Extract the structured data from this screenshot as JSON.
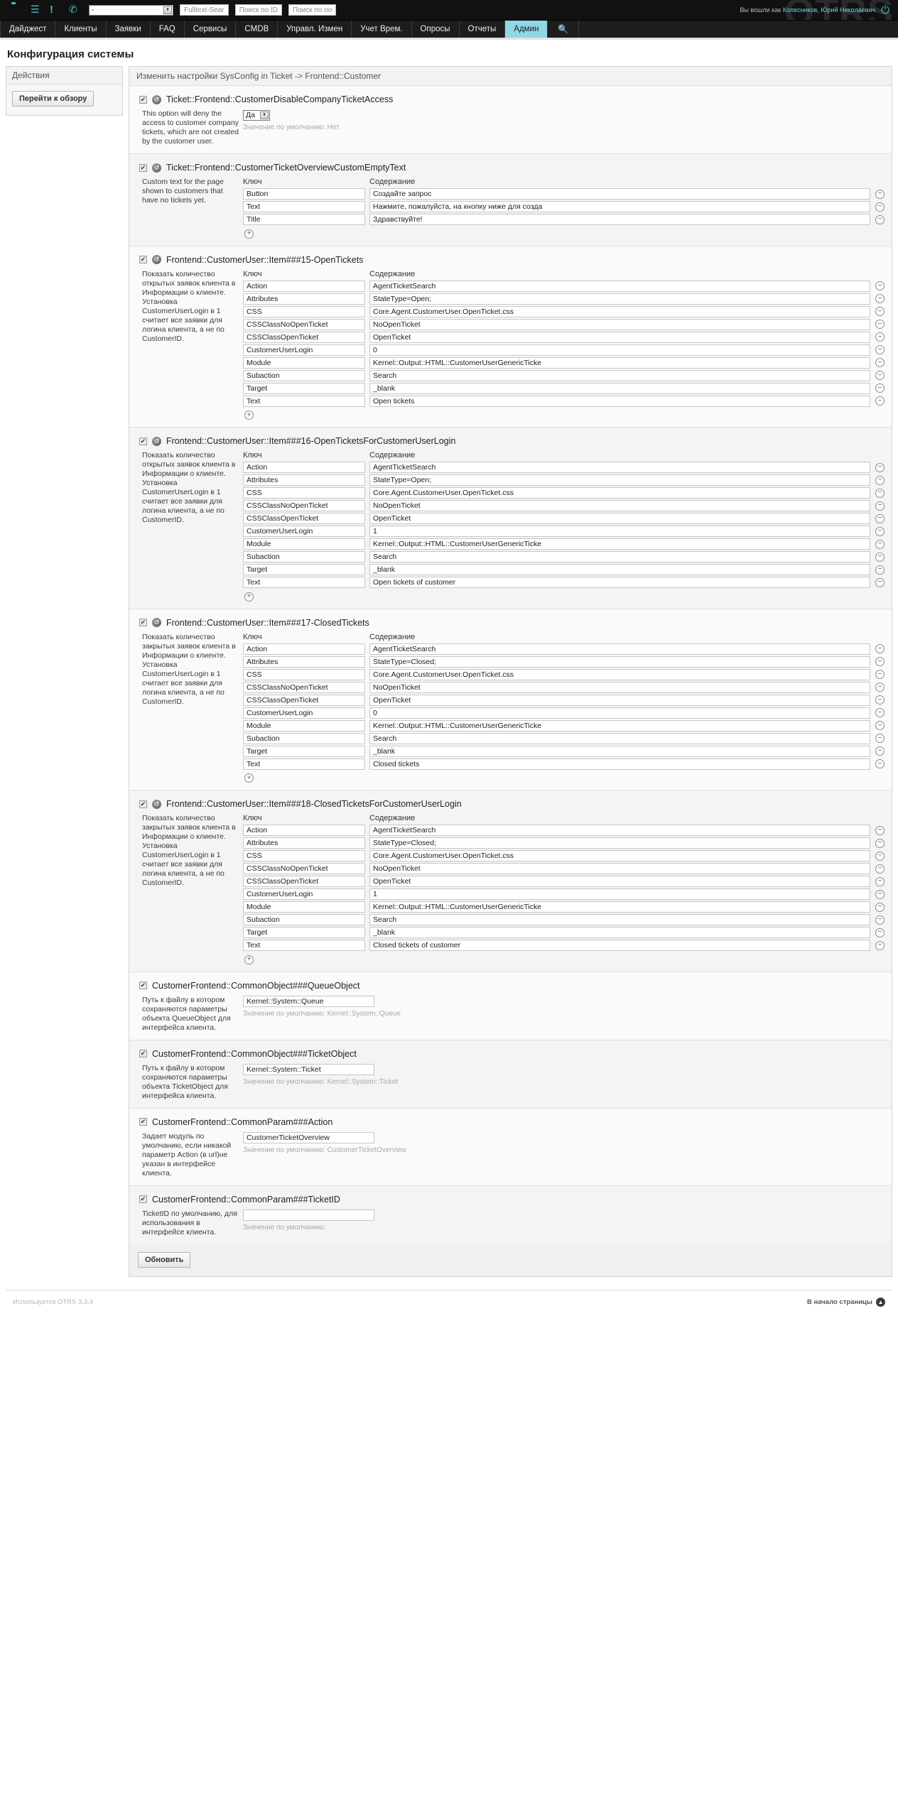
{
  "topbar": {
    "icons": [
      "folder-icon",
      "list-icon",
      "exclamation-icon",
      "phone-icon"
    ],
    "queue_select_value": "-",
    "buttons": [
      {
        "name": "fulltext-search-button",
        "label": "Fulltext-Sear"
      },
      {
        "name": "search-by-id-button",
        "label": "Поиск по ID"
      },
      {
        "name": "search-by-number-button",
        "label": "Поиск по no"
      }
    ],
    "logged_in_prefix": "Вы вошли как ",
    "logged_in_user": "Колесников, Юрий Николаевич",
    "watermark": "OTRS",
    "logout_icon": "power-icon"
  },
  "nav": {
    "items": [
      {
        "label": "Дайджест",
        "active": false
      },
      {
        "label": "Клиенты",
        "active": false
      },
      {
        "label": "Заявки",
        "active": false
      },
      {
        "label": "FAQ",
        "active": false
      },
      {
        "label": "Сервисы",
        "active": false
      },
      {
        "label": "CMDB",
        "active": false
      },
      {
        "label": "Управл. Измен",
        "active": false
      },
      {
        "label": "Учет Врем.",
        "active": false
      },
      {
        "label": "Опросы",
        "active": false
      },
      {
        "label": "Отчеты",
        "active": false
      },
      {
        "label": "Админ",
        "active": true
      }
    ],
    "search_icon": "search-icon"
  },
  "page_title": "Конфигурация системы",
  "sidebar": {
    "header": "Действия",
    "overview_button": "Перейти к обзору"
  },
  "main": {
    "header": "Изменить настройки SysConfig in Ticket -> Frontend::Customer",
    "submit_label": "Обновить",
    "labels": {
      "key": "Ключ",
      "content": "Содержание",
      "default_prefix": "Значение по умолчанию: ",
      "add_icon": "plus-circle-icon",
      "remove_icon": "minus-circle-icon",
      "reset_icon": "reset-icon",
      "checkbox_icon": "checkbox-checked-icon"
    },
    "settings": [
      {
        "name": "Ticket::Frontend::CustomerDisableCompanyTicketAccess",
        "checked": true,
        "has_reset": true,
        "description": "This option will deny the access to customer company tickets, which are not created by the customer user.",
        "type": "select",
        "value": "Да",
        "default": "Нет"
      },
      {
        "name": "Ticket::Frontend::CustomerTicketOverviewCustomEmptyText",
        "checked": true,
        "has_reset": true,
        "description": "Custom text for the page shown to customers that have no tickets yet.",
        "type": "hash",
        "rows": [
          {
            "key": "Button",
            "content": "Создайте запрос"
          },
          {
            "key": "Text",
            "content": "Нажмите, пожалуйста, на кнопку ниже для созда"
          },
          {
            "key": "Title",
            "content": "Здравствуйте!"
          }
        ]
      },
      {
        "name": "Frontend::CustomerUser::Item###15-OpenTickets",
        "checked": true,
        "has_reset": true,
        "description": "Показать количество открытых заявок клиента в Информации о клиенте. Установка CustomerUserLogin в 1 считает все заявки для логина клиента, а не по CustomerID.",
        "type": "hash",
        "rows": [
          {
            "key": "Action",
            "content": "AgentTicketSearch"
          },
          {
            "key": "Attributes",
            "content": "StateType=Open;"
          },
          {
            "key": "CSS",
            "content": "Core.Agent.CustomerUser.OpenTicket.css"
          },
          {
            "key": "CSSClassNoOpenTicket",
            "content": "NoOpenTicket"
          },
          {
            "key": "CSSClassOpenTicket",
            "content": "OpenTicket"
          },
          {
            "key": "CustomerUserLogin",
            "content": "0"
          },
          {
            "key": "Module",
            "content": "Kernel::Output::HTML::CustomerUserGenericTicke"
          },
          {
            "key": "Subaction",
            "content": "Search"
          },
          {
            "key": "Target",
            "content": "_blank"
          },
          {
            "key": "Text",
            "content": "Open tickets"
          }
        ]
      },
      {
        "name": "Frontend::CustomerUser::Item###16-OpenTicketsForCustomerUserLogin",
        "checked": true,
        "has_reset": true,
        "description": "Показать количество открытых заявок клиента в Информации о клиенте. Установка CustomerUserLogin в 1 считает все заявки для логина клиента, а не по CustomerID.",
        "type": "hash",
        "rows": [
          {
            "key": "Action",
            "content": "AgentTicketSearch"
          },
          {
            "key": "Attributes",
            "content": "StateType=Open;"
          },
          {
            "key": "CSS",
            "content": "Core.Agent.CustomerUser.OpenTicket.css"
          },
          {
            "key": "CSSClassNoOpenTicket",
            "content": "NoOpenTicket"
          },
          {
            "key": "CSSClassOpenTicket",
            "content": "OpenTicket"
          },
          {
            "key": "CustomerUserLogin",
            "content": "1"
          },
          {
            "key": "Module",
            "content": "Kernel::Output::HTML::CustomerUserGenericTicke"
          },
          {
            "key": "Subaction",
            "content": "Search"
          },
          {
            "key": "Target",
            "content": "_blank"
          },
          {
            "key": "Text",
            "content": "Open tickets of customer"
          }
        ]
      },
      {
        "name": "Frontend::CustomerUser::Item###17-ClosedTickets",
        "checked": true,
        "has_reset": true,
        "description": "Показать количество закрытых заявок клиента в Информации о клиенте. Установка CustomerUserLogin в 1 считает все заявки для логина клиента, а не по CustomerID.",
        "type": "hash",
        "rows": [
          {
            "key": "Action",
            "content": "AgentTicketSearch"
          },
          {
            "key": "Attributes",
            "content": "StateType=Closed;"
          },
          {
            "key": "CSS",
            "content": "Core.Agent.CustomerUser.OpenTicket.css"
          },
          {
            "key": "CSSClassNoOpenTicket",
            "content": "NoOpenTicket"
          },
          {
            "key": "CSSClassOpenTicket",
            "content": "OpenTicket"
          },
          {
            "key": "CustomerUserLogin",
            "content": "0"
          },
          {
            "key": "Module",
            "content": "Kernel::Output::HTML::CustomerUserGenericTicke"
          },
          {
            "key": "Subaction",
            "content": "Search"
          },
          {
            "key": "Target",
            "content": "_blank"
          },
          {
            "key": "Text",
            "content": "Closed tickets"
          }
        ]
      },
      {
        "name": "Frontend::CustomerUser::Item###18-ClosedTicketsForCustomerUserLogin",
        "checked": true,
        "has_reset": true,
        "description": "Показать количество закрытых заявок клиента в Информации о клиенте. Установка CustomerUserLogin в 1 считает все заявки для логина клиента, а не по CustomerID.",
        "type": "hash",
        "rows": [
          {
            "key": "Action",
            "content": "AgentTicketSearch"
          },
          {
            "key": "Attributes",
            "content": "StateType=Closed;"
          },
          {
            "key": "CSS",
            "content": "Core.Agent.CustomerUser.OpenTicket.css"
          },
          {
            "key": "CSSClassNoOpenTicket",
            "content": "NoOpenTicket"
          },
          {
            "key": "CSSClassOpenTicket",
            "content": "OpenTicket"
          },
          {
            "key": "CustomerUserLogin",
            "content": "1"
          },
          {
            "key": "Module",
            "content": "Kernel::Output::HTML::CustomerUserGenericTicke"
          },
          {
            "key": "Subaction",
            "content": "Search"
          },
          {
            "key": "Target",
            "content": "_blank"
          },
          {
            "key": "Text",
            "content": "Closed tickets of customer"
          }
        ]
      },
      {
        "name": "CustomerFrontend::CommonObject###QueueObject",
        "checked": true,
        "has_reset": false,
        "description": "Путь к файлу в котором сохраняются параметры объекта QueueObject для интерфейса клиента.",
        "type": "text",
        "value": "Kernel::System::Queue",
        "default": "Kernel::System::Queue"
      },
      {
        "name": "CustomerFrontend::CommonObject###TicketObject",
        "checked": true,
        "has_reset": false,
        "description": "Путь к файлу в котором сохраняются параметры объекта TicketObject для интерфейса клиента.",
        "type": "text",
        "value": "Kernel::System::Ticket",
        "default": "Kernel::System::Ticket"
      },
      {
        "name": "CustomerFrontend::CommonParam###Action",
        "checked": true,
        "has_reset": false,
        "description": "Задает модуль по умолчанию, если никакой параметр Action (в url)не указан в интерфейсе клиента.",
        "type": "text",
        "value": "CustomerTicketOverview",
        "default": "CustomerTicketOverview"
      },
      {
        "name": "CustomerFrontend::CommonParam###TicketID",
        "checked": true,
        "has_reset": false,
        "description": "TicketID по умолчанию, для использования в интерфейсе клиента.",
        "type": "text",
        "value": "",
        "default": ""
      }
    ]
  },
  "footer": {
    "powered_by": "Используется OTRS 3.3.4",
    "top_link": "В начало страницы",
    "top_icon": "up-arrow-icon"
  }
}
